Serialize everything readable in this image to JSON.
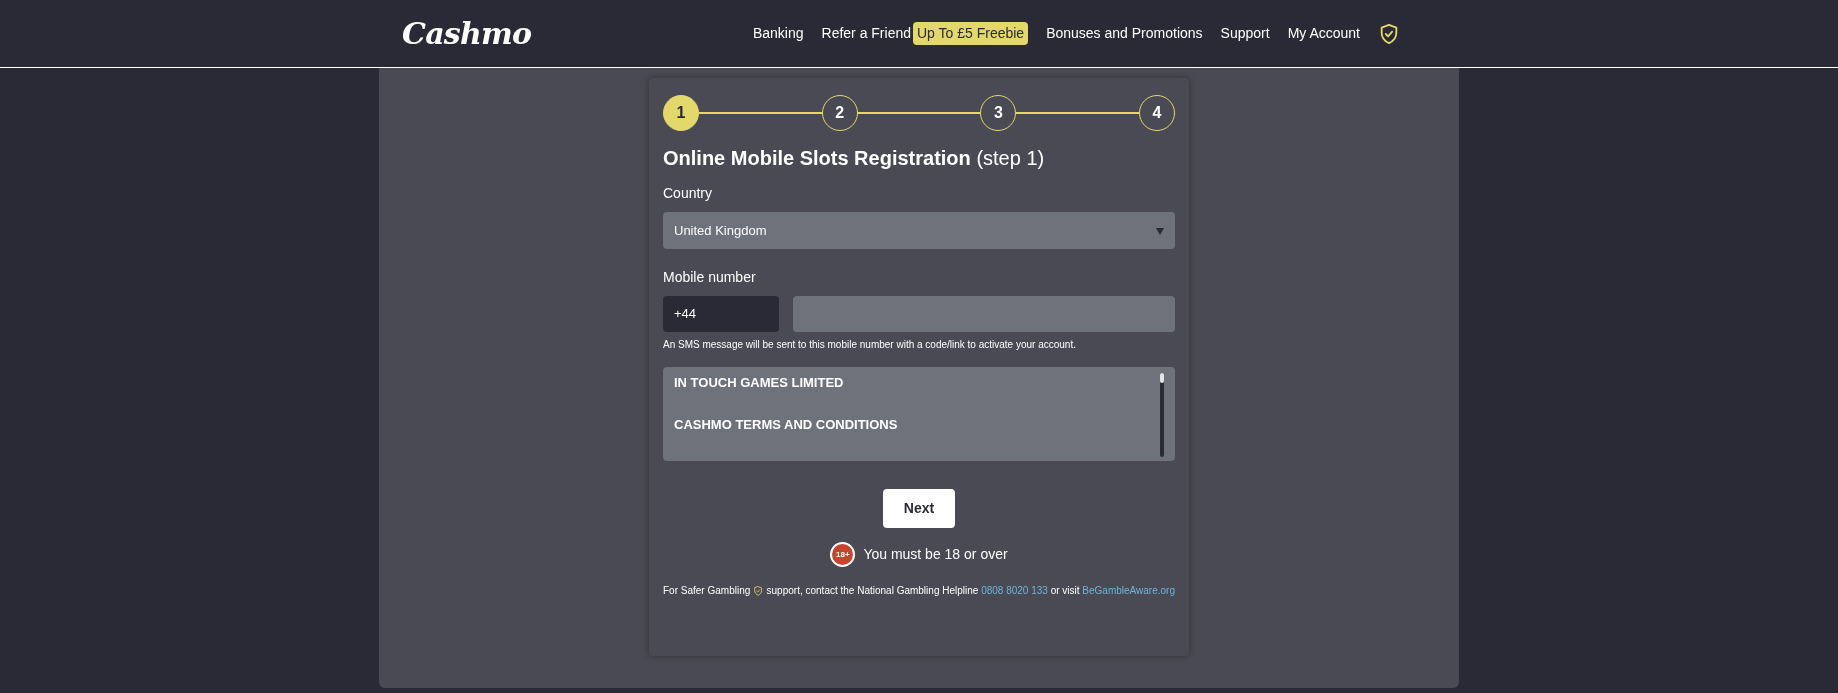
{
  "header": {
    "logo": "Cashmo",
    "nav": [
      {
        "kind": "link",
        "label": "Banking"
      },
      {
        "kind": "link",
        "label": "Refer a Friend"
      },
      {
        "kind": "badge",
        "label": "Up To £5 Freebie"
      },
      {
        "kind": "link",
        "label": "Bonuses and Promotions"
      },
      {
        "kind": "link",
        "label": "Support"
      },
      {
        "kind": "link",
        "label": "My Account"
      }
    ]
  },
  "steps": [
    {
      "label": "1",
      "selected": true
    },
    {
      "label": "2",
      "selected": false
    },
    {
      "label": "3",
      "selected": false
    },
    {
      "label": "4",
      "selected": false
    }
  ],
  "form": {
    "title": "Online Mobile Slots Registration",
    "title_suffix": "(step 1)",
    "country_label": "Country",
    "country_value": "United Kingdom",
    "mobile_label": "Mobile number",
    "dial_code": "+44",
    "sms_note": "An SMS message will be sent to this mobile number with a code/link to activate your account.",
    "terms": [
      "IN TOUCH GAMES LIMITED",
      "CASHMO TERMS AND CONDITIONS"
    ],
    "next_button": "Next",
    "age_badge": "18+",
    "age_text": "You must be 18 or over",
    "safer_lead": "For Safer Gambling",
    "safer_text": "support, contact the National Gambling Helpline",
    "helpline": "0808 8020 133",
    "or_visit": "or visit",
    "aware_link": "BeGambleAware.org"
  }
}
